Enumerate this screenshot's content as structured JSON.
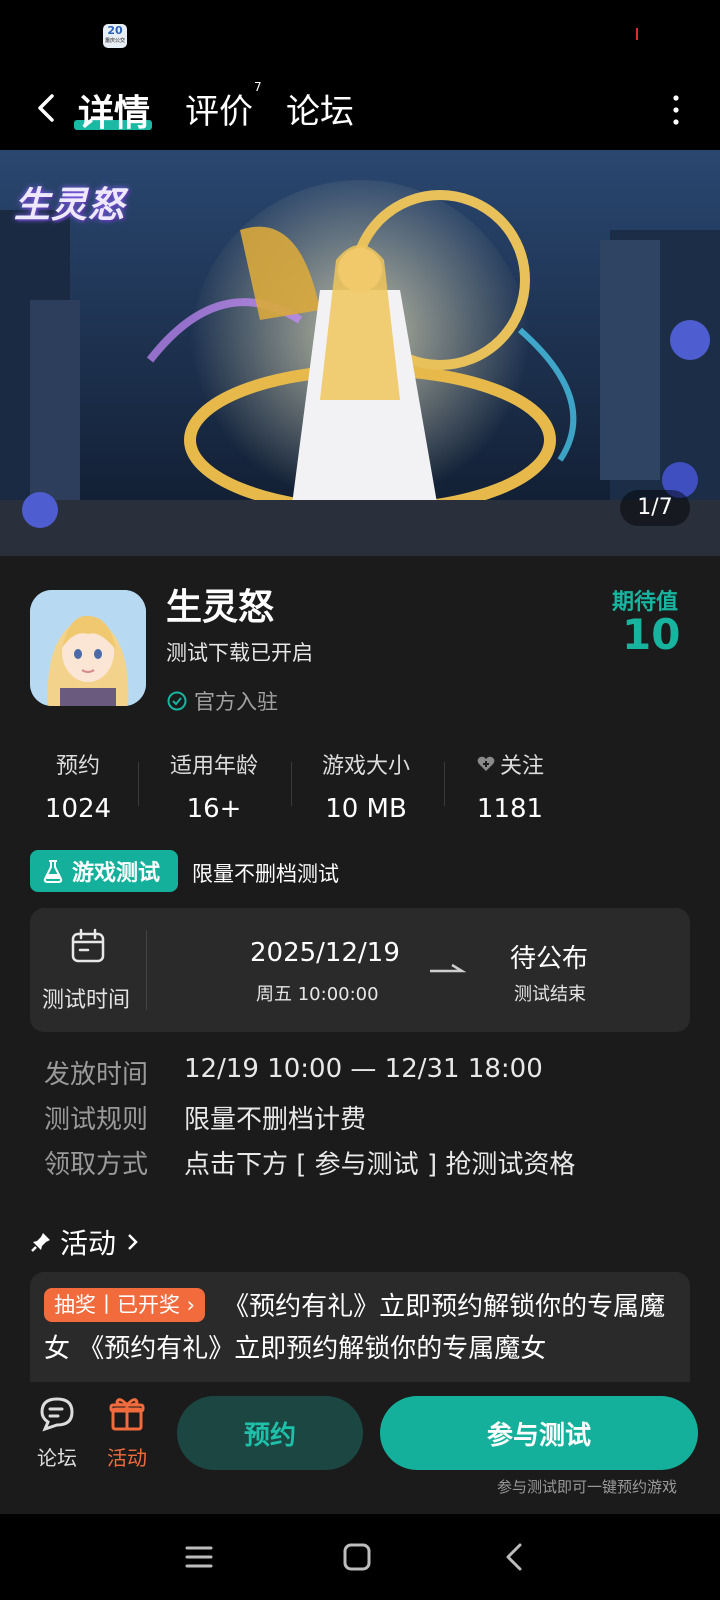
{
  "status_bar": {
    "app_badge": "20",
    "app_badge_sub": "重庆公交"
  },
  "nav": {
    "tabs": [
      {
        "label": "详情",
        "active": true
      },
      {
        "label": "评价",
        "badge": "7"
      },
      {
        "label": "论坛"
      }
    ]
  },
  "banner": {
    "logo_text": "生灵怒",
    "counter": "1/7"
  },
  "game": {
    "title": "生灵怒",
    "subtitle": "测试下载已开启",
    "official": "官方入驻",
    "expect_label": "期待值",
    "expect_value": "10"
  },
  "stats": [
    {
      "label": "预约",
      "value": "1024"
    },
    {
      "label": "适用年龄",
      "value": "16+"
    },
    {
      "label": "游戏大小",
      "value": "10 MB"
    },
    {
      "label": "关注",
      "value": "1181",
      "icon": "heart-plus-icon"
    }
  ],
  "test": {
    "badge": "游戏测试",
    "description": "限量不删档测试",
    "time_label": "测试时间",
    "start_date": "2025/12/19",
    "start_time": "周五  10:00:00",
    "end_value": "待公布",
    "end_label": "测试结束"
  },
  "rules": [
    {
      "key": "发放时间",
      "value": "12/19 10:00 — 12/31 18:00"
    },
    {
      "key": "测试规则",
      "value": "限量不删档计费"
    },
    {
      "key": "领取方式",
      "value": "点击下方 [ 参与测试 ] 抢测试资格"
    }
  ],
  "activity": {
    "heading": "活动",
    "tag": "抽奖丨已开奖 ›",
    "text": "《预约有礼》立即预约解锁你的专属魔女 《预约有礼》立即预约解锁你的专属魔女"
  },
  "bottom_bar": {
    "forum": "论坛",
    "activity": "活动",
    "reserve": "预约",
    "join": "参与测试",
    "join_hint": "参与测试即可一键预约游戏"
  },
  "colors": {
    "accent": "#15b09b",
    "orange": "#f26b3d",
    "background": "#1b1b1b"
  }
}
